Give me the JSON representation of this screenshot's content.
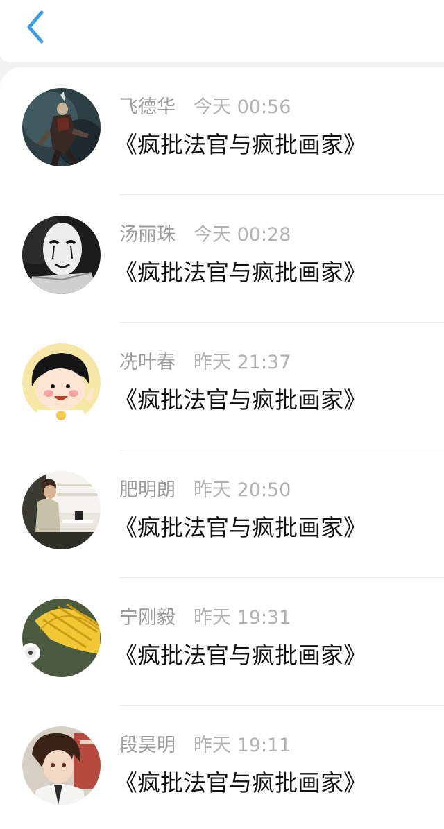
{
  "header": {
    "back_icon": "chevron-left-icon",
    "accent_color": "#3d9ce6"
  },
  "items": [
    {
      "name": "飞德华",
      "time": "今天 00:56",
      "title": "《疯批法官与疯批画家》",
      "avatar": "dark-armored-character"
    },
    {
      "name": "汤丽珠",
      "time": "今天 00:28",
      "title": "《疯批法官与疯批画家》",
      "avatar": "white-mask-face"
    },
    {
      "name": "冼叶春",
      "time": "昨天 21:37",
      "title": "《疯批法官与疯批画家》",
      "avatar": "cartoon-girl"
    },
    {
      "name": "肥明朗",
      "time": "昨天 20:50",
      "title": "《疯批法官与疯批画家》",
      "avatar": "person-at-desk"
    },
    {
      "name": "宁刚毅",
      "time": "昨天 19:31",
      "title": "《疯批法官与疯批画家》",
      "avatar": "yellow-shell"
    },
    {
      "name": "段昊明",
      "time": "昨天 19:11",
      "title": "《疯批法官与疯批画家》",
      "avatar": "anime-boy"
    }
  ]
}
